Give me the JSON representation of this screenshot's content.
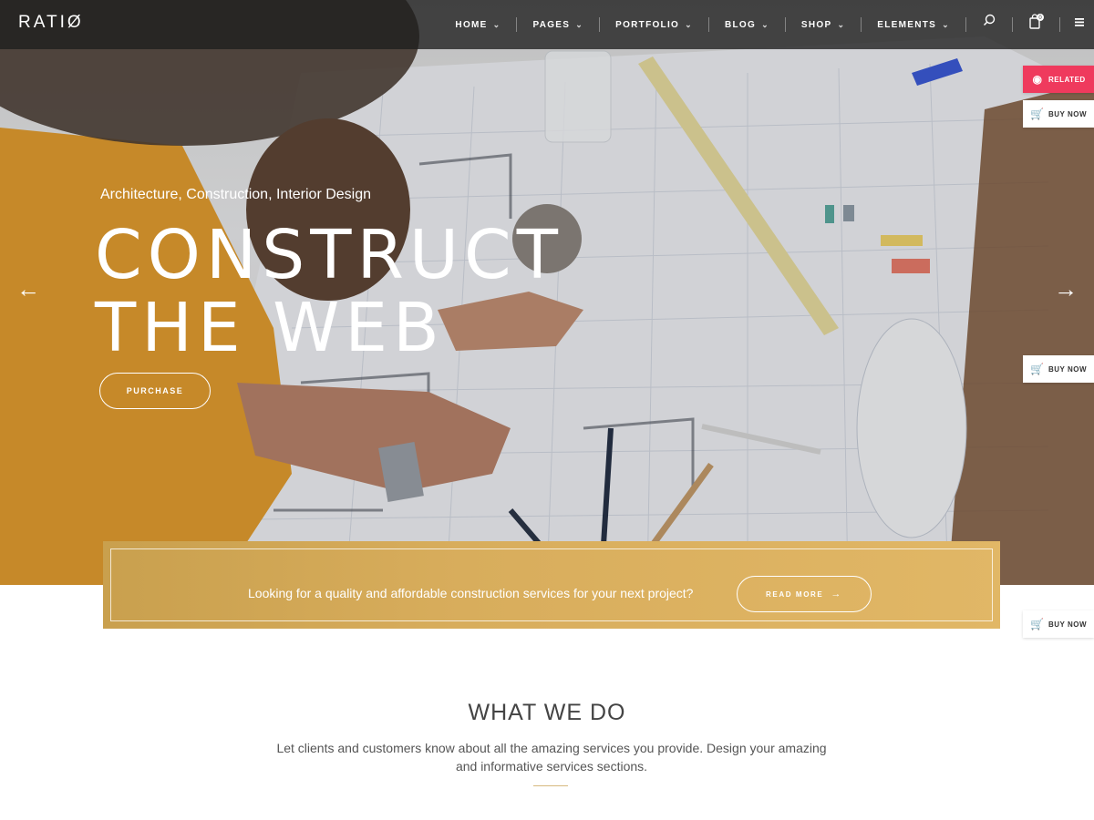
{
  "brand": {
    "logo": "RATIØ"
  },
  "nav": {
    "items": [
      {
        "label": "HOME"
      },
      {
        "label": "PAGES"
      },
      {
        "label": "PORTFOLIO"
      },
      {
        "label": "BLOG"
      },
      {
        "label": "SHOP"
      },
      {
        "label": "ELEMENTS"
      }
    ],
    "cart_count": "0",
    "icons": [
      "search-icon",
      "cart-icon",
      "menu-icon"
    ]
  },
  "hero": {
    "subtitle": "Architecture, Construction, Interior Design",
    "title_line1": "CONSTRUCT",
    "title_line2": "THE WEB",
    "button": "PURCHASE"
  },
  "side": {
    "related": "RELATED",
    "buy_now": "BUY NOW"
  },
  "cta": {
    "text": "Looking for a quality and affordable construction services for your next project?",
    "button": "READ MORE",
    "button_arrow": "→"
  },
  "section": {
    "title": "WHAT WE DO",
    "description": "Let clients and customers know about all the amazing services you provide. Design your amazing and informative services sections."
  },
  "colors": {
    "accent_gold": "#d8ad5c",
    "related_pink": "#ef3a5d",
    "nav_bg": "#1e1e1e"
  }
}
